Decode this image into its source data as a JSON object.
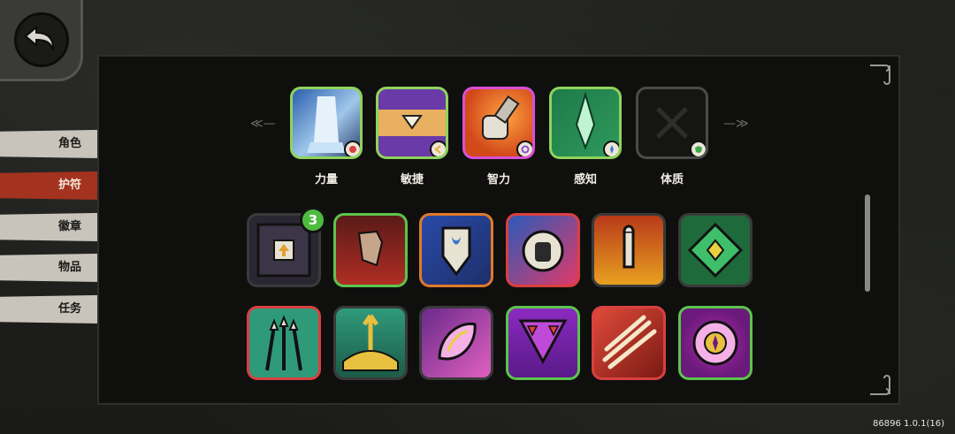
{
  "nav": {
    "back_icon": "back-arrow-icon",
    "tabs": [
      {
        "label": "角色",
        "active": false
      },
      {
        "label": "护符",
        "active": true
      },
      {
        "label": "徽章",
        "active": false
      },
      {
        "label": "物品",
        "active": false
      },
      {
        "label": "任务",
        "active": false
      }
    ]
  },
  "attributes": [
    {
      "label": "力量",
      "border": "#8fd35b",
      "badge_icon": "strength-icon"
    },
    {
      "label": "敏捷",
      "border": "#8fd35b",
      "badge_icon": "agility-icon"
    },
    {
      "label": "智力",
      "border": "#d94fd6",
      "badge_icon": "intellect-icon"
    },
    {
      "label": "感知",
      "border": "#8fd35b",
      "badge_icon": "perception-icon"
    },
    {
      "label": "体质",
      "border": "#555",
      "badge_icon": "constitution-icon"
    }
  ],
  "talents": {
    "row1": [
      {
        "icon": "upgrade-chest-icon",
        "border": "#3a3a3a",
        "count": "3"
      },
      {
        "icon": "grasping-hand-icon",
        "border": "#5cc44b"
      },
      {
        "icon": "tooth-shield-icon",
        "border": "#e07a2a"
      },
      {
        "icon": "fist-burst-icon",
        "border": "#d94040"
      },
      {
        "icon": "bullet-fire-icon",
        "border": "#3a3a3a"
      },
      {
        "icon": "green-rune-icon",
        "border": "#3a3a3a"
      }
    ],
    "row2": [
      {
        "icon": "spears-icon",
        "border": "#d94040"
      },
      {
        "icon": "light-burst-icon",
        "border": "#3a3a3a"
      },
      {
        "icon": "pink-crystal-icon",
        "border": "#3a3a3a"
      },
      {
        "icon": "warning-triangle-icon",
        "border": "#5cc44b"
      },
      {
        "icon": "claw-slash-icon",
        "border": "#d94040"
      },
      {
        "icon": "pink-sigil-icon",
        "border": "#5cc44b"
      }
    ]
  },
  "footer": {
    "version": "86896 1.0.1(16)"
  }
}
